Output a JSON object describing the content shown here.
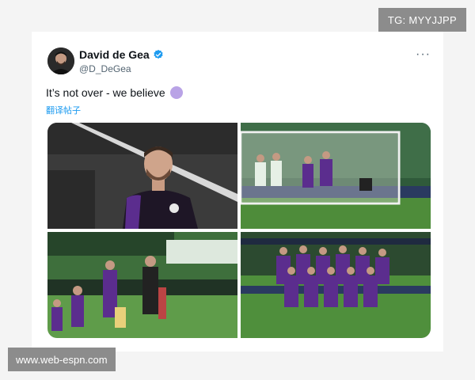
{
  "watermarks": {
    "top_right": "TG: MYYJJPP",
    "bottom_left": "www.web-espn.com"
  },
  "tweet": {
    "display_name": "David de Gea",
    "handle": "@D_DeGea",
    "verified": true,
    "text": "It’s not over - we believe",
    "emoji_icon": "purple-circle-icon",
    "translate_label": "翻译帖子",
    "more_icon": "more-options-icon",
    "more_label": "···"
  },
  "colors": {
    "verified_blue": "#1d9bf0",
    "fiorentina_purple": "#5b2d8e",
    "emoji_purple": "#b9a3e6"
  },
  "photos": [
    {
      "subject": "player-portrait"
    },
    {
      "subject": "penalty-moment"
    },
    {
      "subject": "tunnel-walkout"
    },
    {
      "subject": "team-photo"
    }
  ]
}
